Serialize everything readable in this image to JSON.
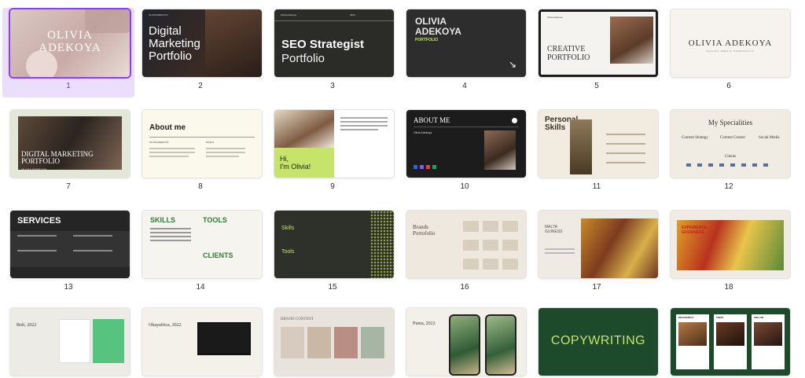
{
  "colors": {
    "selection_border": "#8b3dff",
    "selection_bg": "#e9defc",
    "green_dark": "#1e4a2c",
    "accent_lime": "#c6e46a"
  },
  "slides": [
    {
      "number": "1",
      "title": "OLIVIA\nADEKOYA"
    },
    {
      "number": "2",
      "title": "Digital\nMarketing\nPortfolio",
      "caption": "OLIVIA ADEKOYA"
    },
    {
      "number": "3",
      "title": "SEO Strategist",
      "subtitle": "Portfolio",
      "caption": "Olivia Adekoya",
      "year": "2024"
    },
    {
      "number": "4",
      "title": "OLIVIA\nADEKOYA",
      "subtitle": "PORTFOLIO"
    },
    {
      "number": "5",
      "title": "CREATIVE\nPORTFOLIO",
      "caption": "Olivia Adekoya"
    },
    {
      "number": "6",
      "title": "OLIVIA ADEKOYA",
      "subtitle": "SOCIAL MEDIA PORTFOLIO"
    },
    {
      "number": "7",
      "title": "DIGITAL MARKETING\nPORTFOLIO",
      "caption": "OLIVIA ADEKOYA"
    },
    {
      "number": "8",
      "title": "About me",
      "subtitle": "OLIVIA ADEKOYA",
      "side": "SKILLS"
    },
    {
      "number": "9",
      "title": "Hi,\nI'm Olivia!"
    },
    {
      "number": "10",
      "title": "ABOUT ME",
      "subtitle": "Olivia Adekoya"
    },
    {
      "number": "11",
      "title": "Personal\nSkills"
    },
    {
      "number": "12",
      "title": "My Specialities",
      "items": [
        "Content Strategy",
        "Content Creator",
        "Social Media"
      ],
      "section": "Clients"
    },
    {
      "number": "13",
      "title": "SERVICES"
    },
    {
      "number": "14",
      "title": "SKILLS",
      "section1": "TOOLS",
      "section2": "CLIENTS"
    },
    {
      "number": "15",
      "title": "Skills",
      "section": "Tools"
    },
    {
      "number": "16",
      "title": "Brands\nPortofolio"
    },
    {
      "number": "17",
      "title": "MALTA\nGUINESS"
    },
    {
      "number": "18",
      "title": "EXPERIENCE\nGOODNESS"
    },
    {
      "number": "19",
      "title": "Bolt, 2022"
    },
    {
      "number": "20",
      "title": "Okayafrica, 2022"
    },
    {
      "number": "21",
      "title": "BRAND CONTENT"
    },
    {
      "number": "22",
      "title": "Puma, 2022"
    },
    {
      "number": "23",
      "title": "COPYWRITING"
    },
    {
      "number": "24",
      "cards": [
        "OKAYAFRICA",
        "TEEPL",
        "ZOLLAR"
      ]
    }
  ]
}
